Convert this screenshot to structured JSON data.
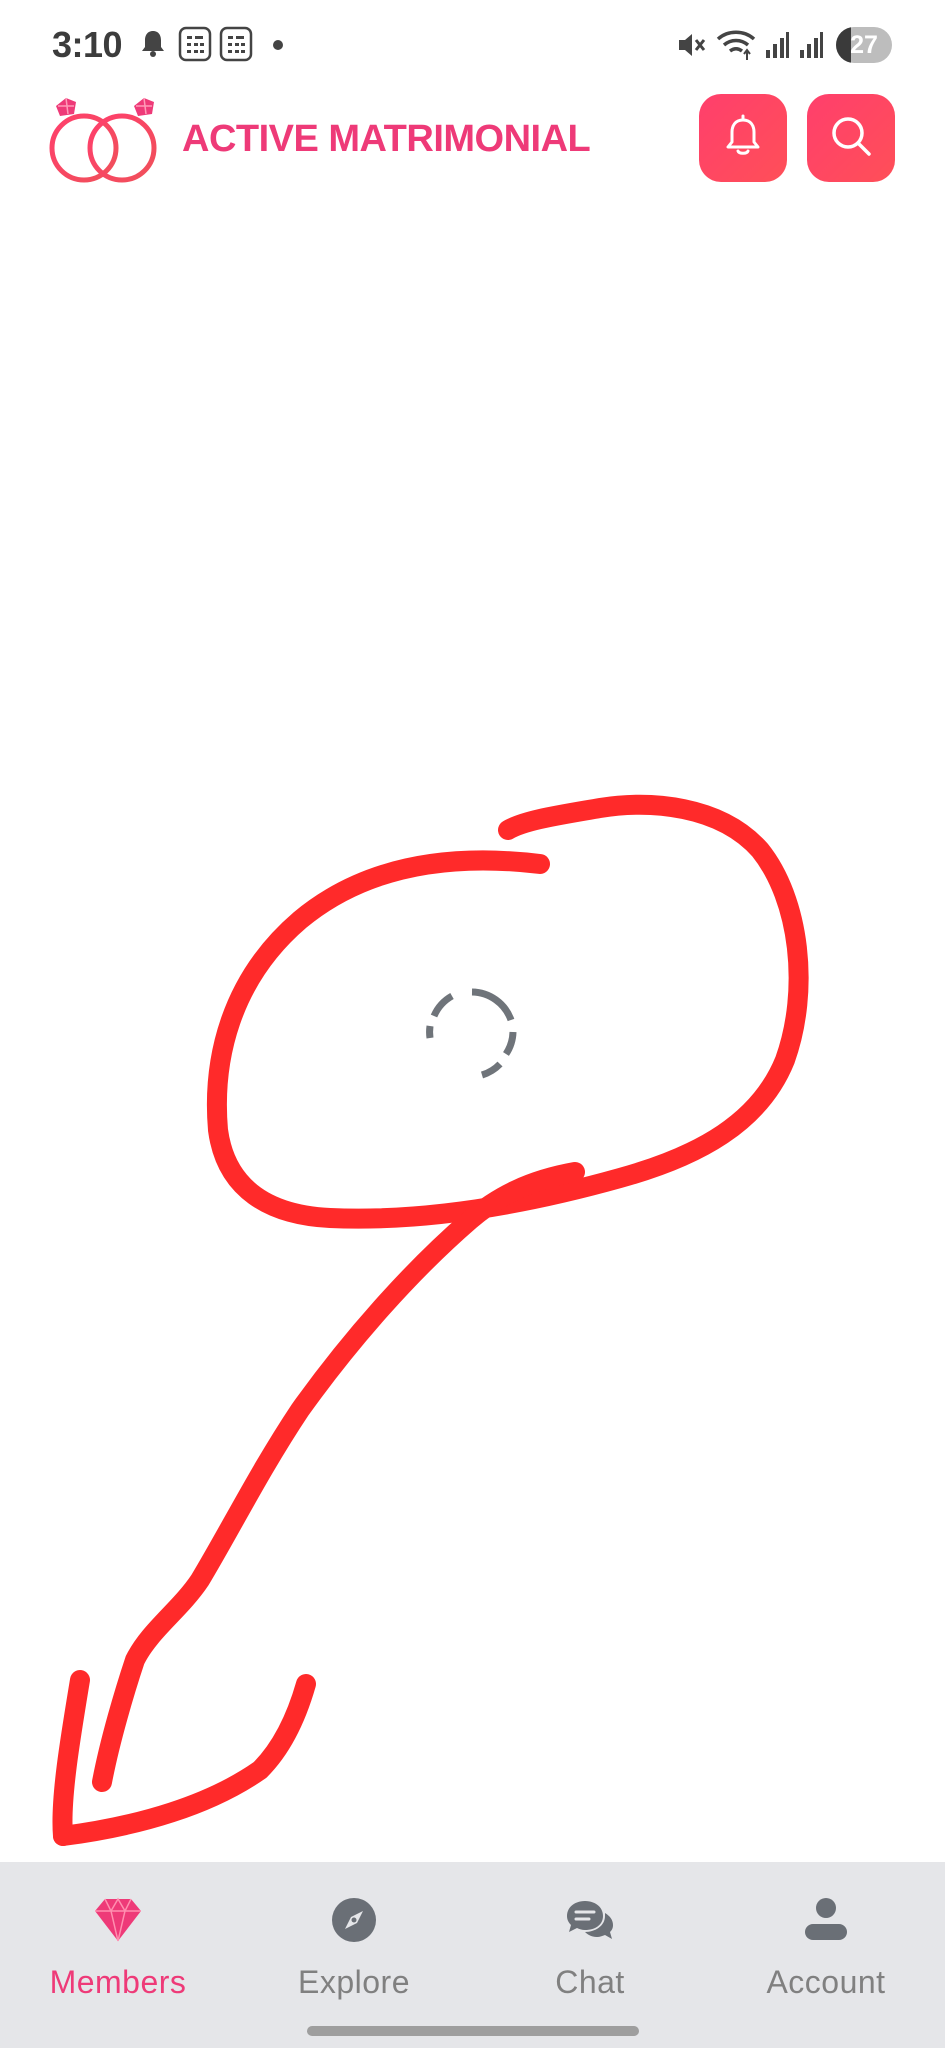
{
  "status_bar": {
    "time": "3:10",
    "battery": "27",
    "battery_level": 0.27,
    "left_icons": [
      "notification-bell-icon",
      "calendar-icon",
      "calendar-icon",
      "dot-icon"
    ],
    "right_icons": [
      "mute-icon",
      "wifi-icon",
      "signal-icon",
      "signal-icon"
    ]
  },
  "header": {
    "title": "ACTIVE MATRIMONIAL",
    "logo_icon": "wedding-rings-icon",
    "buttons": [
      {
        "name": "notifications",
        "icon": "bell-icon"
      },
      {
        "name": "search",
        "icon": "search-icon"
      }
    ],
    "accent_color": "#ee3a78"
  },
  "content": {
    "state": "loading",
    "spinner_icon": "loading-spinner-icon",
    "annotation_color": "#ff2a2a"
  },
  "bottom_nav": {
    "items": [
      {
        "label": "Members",
        "icon": "diamond-icon",
        "active": true
      },
      {
        "label": "Explore",
        "icon": "compass-icon",
        "active": false
      },
      {
        "label": "Chat",
        "icon": "chat-bubbles-icon",
        "active": false
      },
      {
        "label": "Account",
        "icon": "person-icon",
        "active": false
      }
    ],
    "active_color": "#ee3a78",
    "inactive_color": "#808080"
  }
}
